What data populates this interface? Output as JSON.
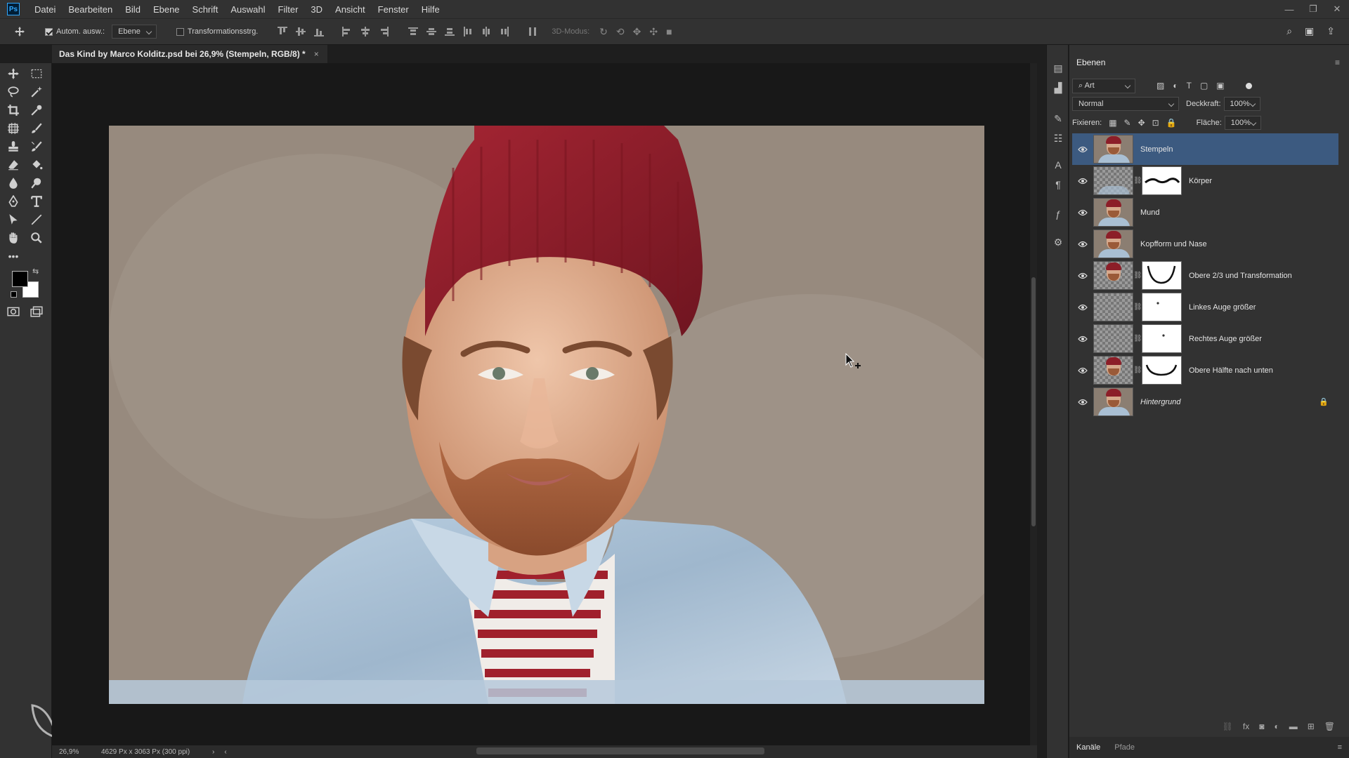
{
  "menubar": {
    "logo": "Ps",
    "items": [
      "Datei",
      "Bearbeiten",
      "Bild",
      "Ebene",
      "Schrift",
      "Auswahl",
      "Filter",
      "3D",
      "Ansicht",
      "Fenster",
      "Hilfe"
    ]
  },
  "options": {
    "auto_select_label": "Autom. ausw.:",
    "auto_select_value": "Ebene",
    "transform_label": "Transformationsstrg.",
    "mode3d_label": "3D-Modus:"
  },
  "document": {
    "tab_title": "Das Kind by Marco Kolditz.psd bei 26,9% (Stempeln, RGB/8) *",
    "tab_close": "×"
  },
  "status": {
    "zoom": "26,9%",
    "doc_info": "4629 Px x 3063 Px (300 ppi)"
  },
  "layers_panel": {
    "title": "Ebenen",
    "filter_value": "Art",
    "blend_mode": "Normal",
    "opacity_label": "Deckkraft:",
    "opacity_value": "100%",
    "lock_label": "Fixieren:",
    "fill_label": "Fläche:",
    "fill_value": "100%",
    "layers": [
      {
        "name": "Stempeln",
        "active": true,
        "mask": false
      },
      {
        "name": "Körper",
        "active": false,
        "mask": true
      },
      {
        "name": "Mund",
        "active": false,
        "mask": false
      },
      {
        "name": "Kopfform und Nase",
        "active": false,
        "mask": false
      },
      {
        "name": "Obere 2/3 und Transformation",
        "active": false,
        "mask": true
      },
      {
        "name": "Linkes Auge größer",
        "active": false,
        "mask": true
      },
      {
        "name": "Rechtes Auge größer",
        "active": false,
        "mask": true
      },
      {
        "name": "Obere Hälfte nach unten",
        "active": false,
        "mask": true
      },
      {
        "name": "Hintergrund",
        "active": false,
        "mask": false,
        "locked": true
      }
    ]
  },
  "bottom_tabs": {
    "channels": "Kanäle",
    "paths": "Pfade"
  },
  "colors": {
    "accent": "#3c5a80",
    "photo_bg": "#978a7e",
    "hat": "#8c1e28"
  }
}
